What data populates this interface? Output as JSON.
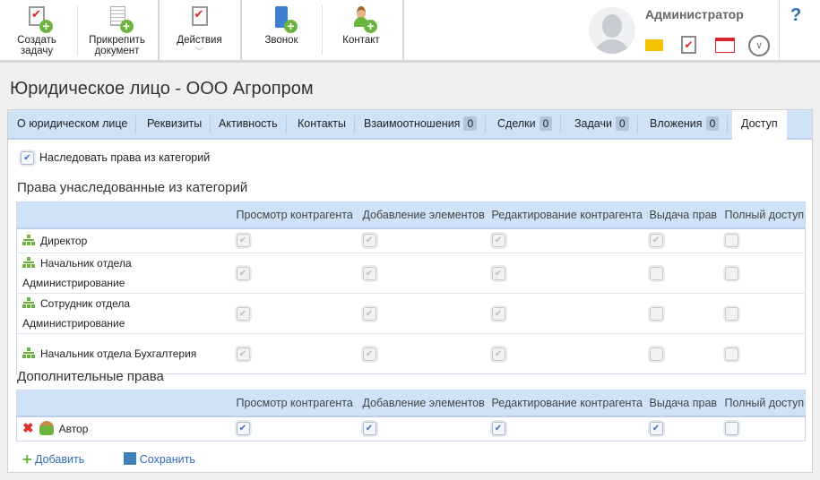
{
  "toolbar": {
    "create_task": "Создать задачу",
    "attach_doc": "Прикрепить документ",
    "actions": "Действия",
    "call": "Звонок",
    "contact": "Контакт"
  },
  "user": {
    "name": "Администратор",
    "help": "?"
  },
  "page_title": "Юридическое лицо - ООО Агропром",
  "tabs": [
    {
      "label": "О юридическом лице"
    },
    {
      "label": "Реквизиты"
    },
    {
      "label": "Активность"
    },
    {
      "label": "Контакты"
    },
    {
      "label": "Взаимоотношения",
      "count": "0"
    },
    {
      "label": "Сделки",
      "count": "0"
    },
    {
      "label": "Задачи",
      "count": "0"
    },
    {
      "label": "Вложения",
      "count": "0"
    },
    {
      "label": "Доступ",
      "active": true
    }
  ],
  "inherit_label": "Наследовать права из категорий",
  "inherit_checked": true,
  "columns": [
    "Просмотр контрагента",
    "Добавление элементов",
    "Редактирование контрагента",
    "Выдача прав",
    "Полный доступ"
  ],
  "inherited": {
    "title": "Права унаследованные из категорий",
    "rows": [
      {
        "name": "Директор",
        "rights": [
          true,
          true,
          true,
          true,
          false
        ]
      },
      {
        "name": "Начальник отдела Администрирование",
        "rights": [
          true,
          true,
          true,
          false,
          false
        ]
      },
      {
        "name": "Сотрудник отдела Администрирование",
        "rights": [
          true,
          true,
          true,
          false,
          false
        ]
      },
      {
        "name": "Начальник отдела Бухгалтерия",
        "rights": [
          true,
          true,
          true,
          false,
          false
        ]
      }
    ]
  },
  "additional": {
    "title": "Дополнительные права",
    "rows": [
      {
        "name": "Автор",
        "rights": [
          true,
          true,
          true,
          true,
          false
        ]
      }
    ]
  },
  "buttons": {
    "add": "Добавить",
    "save": "Сохранить"
  }
}
